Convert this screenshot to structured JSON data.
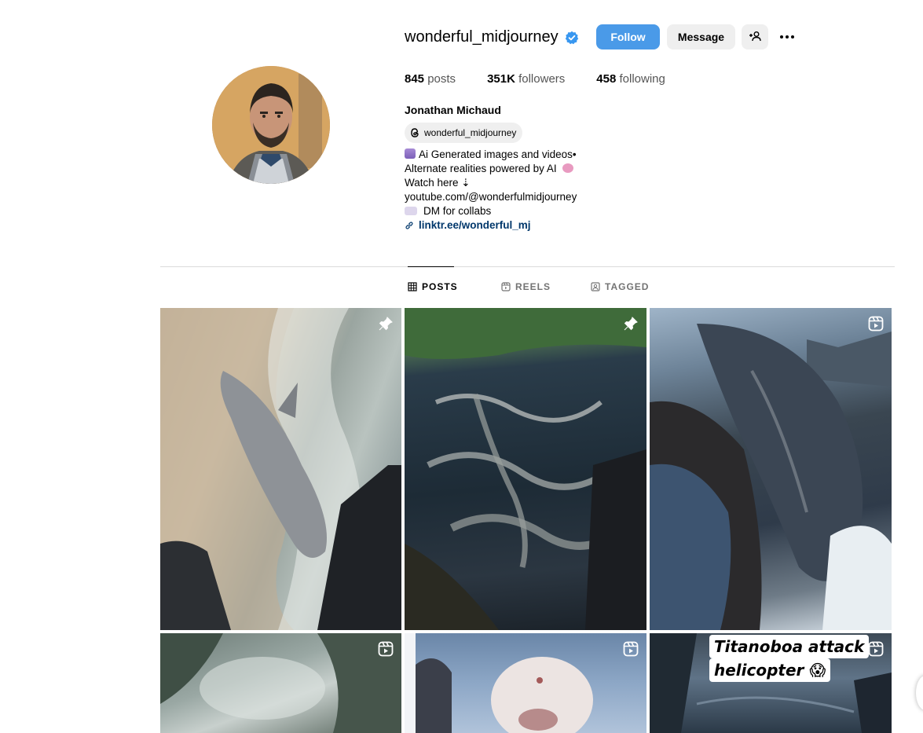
{
  "profile": {
    "username": "wonderful_midjourney",
    "verified": true,
    "full_name": "Jonathan Michaud",
    "threads_handle": "wonderful_midjourney"
  },
  "actions": {
    "follow_label": "Follow",
    "message_label": "Message"
  },
  "stats": {
    "posts_count": "845",
    "posts_label": "posts",
    "followers_count": "351K",
    "followers_label": "followers",
    "following_count": "458",
    "following_label": "following"
  },
  "bio": {
    "line1": "Ai Generated images and videos•",
    "line2": "Alternate realities powered by AI",
    "line3": "Watch here ⇣",
    "line4": "youtube.com/@wonderfulmidjourney",
    "line5": "DM for collabs",
    "link": "linktr.ee/wonderful_mj"
  },
  "tabs": [
    {
      "label": "POSTS",
      "active": true
    },
    {
      "label": "REELS",
      "active": false
    },
    {
      "label": "TAGGED",
      "active": false
    }
  ],
  "posts": [
    {
      "badge": "pin-icon"
    },
    {
      "badge": "pin-icon"
    },
    {
      "badge": "reel-icon"
    },
    {
      "badge": "reel-icon"
    },
    {
      "badge": "reel-icon"
    },
    {
      "badge": "reel-icon",
      "caption_line1": "Titanoboa attack",
      "caption_line2": "helicopter 😱"
    }
  ],
  "colors": {
    "accent": "#4a9ae8",
    "verified": "#3897f0",
    "link": "#00376b",
    "muted": "#737373"
  }
}
